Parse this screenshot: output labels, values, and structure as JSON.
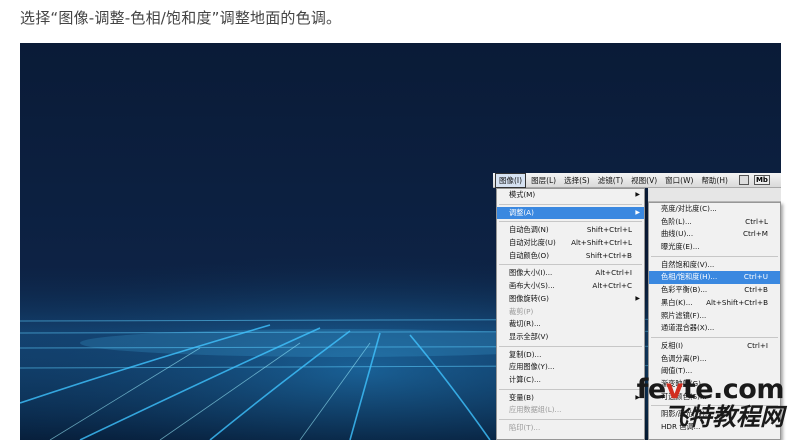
{
  "caption": "选择“图像-调整-色相/饱和度”调整地面的色调。",
  "menubar": {
    "items": [
      "图像(I)",
      "图层(L)",
      "选择(S)",
      "滤镜(T)",
      "视图(V)",
      "窗口(W)",
      "帮助(H)"
    ],
    "tail": "Mb"
  },
  "image_menu": [
    {
      "label": "模式(M)",
      "shortcut": "",
      "arrow": true
    },
    {
      "sep": true
    },
    {
      "label": "调整(A)",
      "shortcut": "",
      "arrow": true,
      "highlight": true
    },
    {
      "sep": true
    },
    {
      "label": "自动色调(N)",
      "shortcut": "Shift+Ctrl+L"
    },
    {
      "label": "自动对比度(U)",
      "shortcut": "Alt+Shift+Ctrl+L"
    },
    {
      "label": "自动颜色(O)",
      "shortcut": "Shift+Ctrl+B"
    },
    {
      "sep": true
    },
    {
      "label": "图像大小(I)...",
      "shortcut": "Alt+Ctrl+I"
    },
    {
      "label": "画布大小(S)...",
      "shortcut": "Alt+Ctrl+C"
    },
    {
      "label": "图像旋转(G)",
      "shortcut": "",
      "arrow": true
    },
    {
      "label": "裁剪(P)",
      "shortcut": "",
      "disabled": true
    },
    {
      "label": "裁切(R)...",
      "shortcut": ""
    },
    {
      "label": "显示全部(V)",
      "shortcut": ""
    },
    {
      "sep": true
    },
    {
      "label": "复制(D)...",
      "shortcut": ""
    },
    {
      "label": "应用图像(Y)...",
      "shortcut": ""
    },
    {
      "label": "计算(C)...",
      "shortcut": ""
    },
    {
      "sep": true
    },
    {
      "label": "变量(B)",
      "shortcut": "",
      "arrow": true
    },
    {
      "label": "应用数据组(L)...",
      "shortcut": "",
      "disabled": true
    },
    {
      "sep": true
    },
    {
      "label": "陷印(T)...",
      "shortcut": "",
      "disabled": true
    }
  ],
  "adjust_menu": [
    {
      "label": "亮度/对比度(C)...",
      "shortcut": ""
    },
    {
      "label": "色阶(L)...",
      "shortcut": "Ctrl+L"
    },
    {
      "label": "曲线(U)...",
      "shortcut": "Ctrl+M"
    },
    {
      "label": "曝光度(E)...",
      "shortcut": ""
    },
    {
      "sep": true
    },
    {
      "label": "自然饱和度(V)...",
      "shortcut": ""
    },
    {
      "label": "色相/饱和度(H)...",
      "shortcut": "Ctrl+U",
      "highlight": true
    },
    {
      "label": "色彩平衡(B)...",
      "shortcut": "Ctrl+B"
    },
    {
      "label": "黑白(K)...",
      "shortcut": "Alt+Shift+Ctrl+B"
    },
    {
      "label": "照片滤镜(F)...",
      "shortcut": ""
    },
    {
      "label": "通道混合器(X)...",
      "shortcut": ""
    },
    {
      "sep": true
    },
    {
      "label": "反相(I)",
      "shortcut": "Ctrl+I"
    },
    {
      "label": "色调分离(P)...",
      "shortcut": ""
    },
    {
      "label": "阈值(T)...",
      "shortcut": ""
    },
    {
      "label": "渐变映射(G)...",
      "shortcut": ""
    },
    {
      "label": "可选颜色(S)...",
      "shortcut": ""
    },
    {
      "sep": true
    },
    {
      "label": "阴影/高光(W)...",
      "shortcut": ""
    },
    {
      "label": "HDR 色调...",
      "shortcut": ""
    }
  ],
  "watermark": {
    "line1_a": "fe",
    "line1_b": "v",
    "line1_c": "te.com",
    "line2": "飞特教程网"
  }
}
